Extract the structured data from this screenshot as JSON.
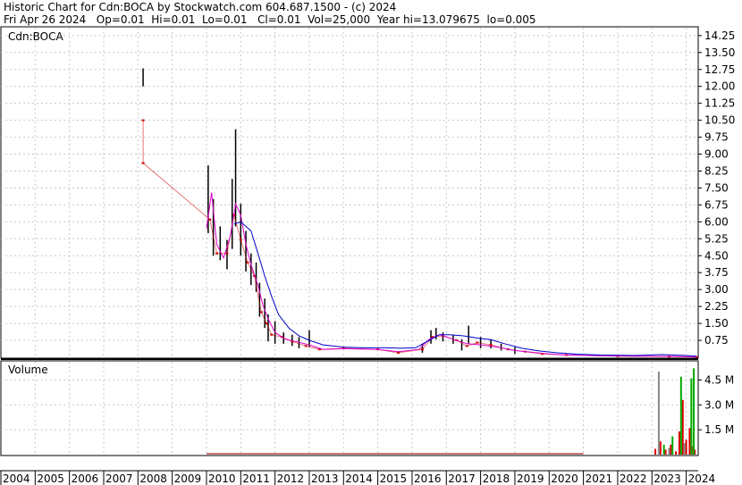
{
  "header": {
    "line1": "Historic Chart for Cdn:BOCA by Stockwatch.com 604.687.1500 - (c) 2024",
    "line2": "Fri Apr 26 2024   Op=0.01  Hi=0.01  Lo=0.01   Cl=0.01  Vol=25,000  Year hi=13.079675  lo=0.005"
  },
  "chart_data": [
    {
      "type": "line",
      "panel": "price",
      "symbol_label": "Cdn:BOCA",
      "ylim": [
        0,
        14.6
      ],
      "y_ticks": [
        "14.25",
        "13.50",
        "12.75",
        "12.00",
        "11.25",
        "10.50",
        "9.75",
        "9.00",
        "8.25",
        "7.50",
        "6.75",
        "6.00",
        "5.25",
        "4.50",
        "3.75",
        "3.00",
        "2.25",
        "1.50",
        "0.75"
      ],
      "x_ticks": [
        "2004",
        "2005",
        "2006",
        "2007",
        "2008",
        "2009",
        "2010",
        "2011",
        "2012",
        "2013",
        "2014",
        "2015",
        "2016",
        "2017",
        "2018",
        "2019",
        "2020",
        "2021",
        "2022",
        "2023",
        "2024"
      ],
      "series": [
        {
          "key": "price_range",
          "color": "#000000",
          "bars": [
            [
              2008.15,
              12.0,
              12.8
            ],
            [
              2010.05,
              5.5,
              8.5
            ],
            [
              2010.2,
              4.5,
              7.0
            ],
            [
              2010.4,
              4.3,
              5.8
            ],
            [
              2010.6,
              3.9,
              5.2
            ],
            [
              2010.75,
              4.8,
              7.9
            ],
            [
              2010.85,
              5.8,
              10.1
            ],
            [
              2011.0,
              4.5,
              6.8
            ],
            [
              2011.15,
              3.8,
              5.6
            ],
            [
              2011.3,
              3.2,
              4.6
            ],
            [
              2011.45,
              2.9,
              4.2
            ],
            [
              2011.55,
              1.8,
              3.3
            ],
            [
              2011.7,
              1.3,
              2.6
            ],
            [
              2011.8,
              0.7,
              1.9
            ],
            [
              2012.0,
              0.6,
              1.6
            ],
            [
              2012.25,
              0.6,
              1.1
            ],
            [
              2012.5,
              0.5,
              1.0
            ],
            [
              2012.7,
              0.4,
              0.9
            ],
            [
              2013.0,
              0.45,
              1.2
            ],
            [
              2016.3,
              0.2,
              0.6
            ],
            [
              2016.55,
              0.6,
              1.2
            ],
            [
              2016.7,
              0.8,
              1.3
            ],
            [
              2016.9,
              0.7,
              1.1
            ],
            [
              2017.2,
              0.6,
              1.0
            ],
            [
              2017.45,
              0.3,
              0.8
            ],
            [
              2017.65,
              0.6,
              1.4
            ],
            [
              2018.0,
              0.4,
              0.9
            ],
            [
              2018.3,
              0.4,
              0.8
            ],
            [
              2018.6,
              0.3,
              0.6
            ],
            [
              2019.0,
              0.15,
              0.45
            ]
          ]
        },
        {
          "key": "price_close",
          "color": "#cc0000",
          "points": [
            [
              2008.15,
              10.5
            ],
            [
              2008.15,
              8.6
            ],
            [
              2010.1,
              6.1
            ],
            [
              2010.3,
              4.6
            ],
            [
              2010.6,
              4.6
            ],
            [
              2010.8,
              6.3
            ],
            [
              2011.0,
              5.2
            ],
            [
              2011.2,
              4.2
            ],
            [
              2011.4,
              3.6
            ],
            [
              2011.6,
              2.0
            ],
            [
              2011.75,
              1.5
            ],
            [
              2011.9,
              1.0
            ],
            [
              2012.2,
              0.9
            ],
            [
              2012.5,
              0.7
            ],
            [
              2012.9,
              0.5
            ],
            [
              2013.3,
              0.35
            ],
            [
              2014.0,
              0.4
            ],
            [
              2015.0,
              0.35
            ],
            [
              2015.6,
              0.2
            ],
            [
              2016.3,
              0.35
            ],
            [
              2016.6,
              0.9
            ],
            [
              2016.9,
              0.95
            ],
            [
              2017.3,
              0.75
            ],
            [
              2017.6,
              0.5
            ],
            [
              2017.9,
              0.65
            ],
            [
              2018.3,
              0.55
            ],
            [
              2018.8,
              0.35
            ],
            [
              2019.3,
              0.25
            ],
            [
              2019.8,
              0.15
            ],
            [
              2020.5,
              0.1
            ],
            [
              2022.0,
              0.05
            ],
            [
              2023.5,
              0.03
            ],
            [
              2024.3,
              0.01
            ]
          ]
        },
        {
          "key": "ma_short",
          "color": "#dd00cc",
          "points": [
            [
              2010.0,
              5.7
            ],
            [
              2010.15,
              7.3
            ],
            [
              2010.3,
              5.0
            ],
            [
              2010.5,
              4.4
            ],
            [
              2010.7,
              5.4
            ],
            [
              2010.85,
              6.8
            ],
            [
              2011.0,
              6.3
            ],
            [
              2011.15,
              5.0
            ],
            [
              2011.3,
              4.1
            ],
            [
              2011.5,
              3.2
            ],
            [
              2011.65,
              2.3
            ],
            [
              2011.8,
              1.7
            ],
            [
              2012.0,
              1.1
            ],
            [
              2012.3,
              0.8
            ],
            [
              2012.6,
              0.7
            ],
            [
              2013.0,
              0.55
            ],
            [
              2013.4,
              0.35
            ],
            [
              2014.0,
              0.38
            ],
            [
              2015.0,
              0.35
            ],
            [
              2015.6,
              0.25
            ],
            [
              2016.2,
              0.35
            ],
            [
              2016.5,
              0.8
            ],
            [
              2016.8,
              1.0
            ],
            [
              2017.2,
              0.8
            ],
            [
              2017.6,
              0.6
            ],
            [
              2018.0,
              0.55
            ],
            [
              2018.5,
              0.45
            ],
            [
              2019.0,
              0.3
            ],
            [
              2019.5,
              0.22
            ],
            [
              2020.0,
              0.15
            ],
            [
              2020.5,
              0.1
            ],
            [
              2021.5,
              0.07
            ],
            [
              2022.5,
              0.05
            ],
            [
              2023.5,
              0.04
            ],
            [
              2024.3,
              0.02
            ]
          ]
        },
        {
          "key": "ma_long",
          "color": "#0000cc",
          "points": [
            [
              2010.8,
              5.9
            ],
            [
              2011.0,
              6.0
            ],
            [
              2011.3,
              5.6
            ],
            [
              2011.5,
              4.6
            ],
            [
              2011.7,
              3.6
            ],
            [
              2011.9,
              2.7
            ],
            [
              2012.1,
              1.9
            ],
            [
              2012.4,
              1.3
            ],
            [
              2012.7,
              0.95
            ],
            [
              2013.0,
              0.75
            ],
            [
              2013.4,
              0.55
            ],
            [
              2014.0,
              0.45
            ],
            [
              2014.6,
              0.42
            ],
            [
              2015.2,
              0.42
            ],
            [
              2015.7,
              0.4
            ],
            [
              2016.1,
              0.42
            ],
            [
              2016.5,
              0.75
            ],
            [
              2016.8,
              1.0
            ],
            [
              2017.1,
              1.0
            ],
            [
              2017.5,
              0.95
            ],
            [
              2017.9,
              0.85
            ],
            [
              2018.3,
              0.78
            ],
            [
              2018.7,
              0.6
            ],
            [
              2019.2,
              0.4
            ],
            [
              2019.7,
              0.28
            ],
            [
              2020.2,
              0.2
            ],
            [
              2020.8,
              0.14
            ],
            [
              2021.5,
              0.1
            ],
            [
              2022.5,
              0.08
            ],
            [
              2023.3,
              0.12
            ],
            [
              2023.8,
              0.09
            ],
            [
              2024.3,
              0.05
            ]
          ]
        }
      ]
    },
    {
      "type": "bar",
      "panel": "volume",
      "title": "Volume",
      "ylim": [
        0,
        5.6
      ],
      "y_ticks": [
        "4.5 M",
        "3.0 M",
        "1.5 M"
      ],
      "series": [
        {
          "key": "volume_red",
          "color": "#dd0000",
          "bars": [
            [
              2023.1,
              0.35
            ],
            [
              2023.25,
              0.8
            ],
            [
              2023.4,
              0.3
            ],
            [
              2023.55,
              0.6
            ],
            [
              2023.7,
              0.2
            ],
            [
              2023.8,
              1.4
            ],
            [
              2023.9,
              3.3
            ],
            [
              2024.0,
              0.9
            ],
            [
              2024.1,
              1.6
            ],
            [
              2024.2,
              0.5
            ],
            [
              2024.25,
              0.3
            ]
          ]
        },
        {
          "key": "volume_green",
          "color": "#00aa00",
          "bars": [
            [
              2023.35,
              0.6
            ],
            [
              2023.6,
              1.1
            ],
            [
              2023.85,
              4.7
            ],
            [
              2024.15,
              4.6
            ],
            [
              2024.22,
              5.2
            ]
          ]
        },
        {
          "key": "volume_gray",
          "color": "#888888",
          "bars": [
            [
              2023.2,
              5.0
            ],
            [
              2023.5,
              0.4
            ],
            [
              2023.95,
              0.7
            ]
          ]
        }
      ]
    }
  ]
}
